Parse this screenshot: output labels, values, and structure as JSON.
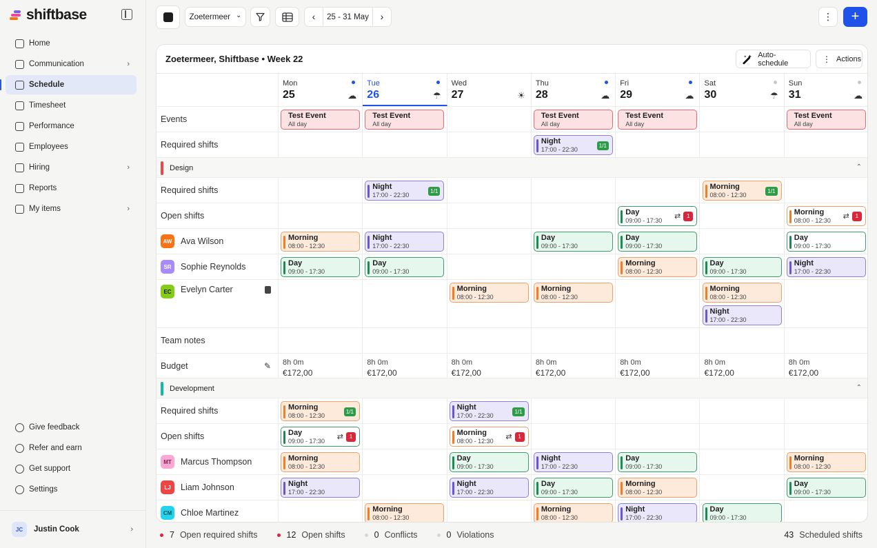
{
  "app": {
    "logo_text": "shiftbase",
    "colors": {
      "accent": "#1f52e8",
      "event": "#e02b3a",
      "night": "#6b55d3",
      "morning": "#ef7d2a",
      "day": "#1e8a52"
    }
  },
  "sidebar": {
    "items": [
      {
        "label": "Home",
        "icon": "home-icon",
        "chevron": "",
        "active": false
      },
      {
        "label": "Communication",
        "icon": "chat-icon",
        "chevron": "›",
        "active": false
      },
      {
        "label": "Schedule",
        "icon": "calendar-icon",
        "chevron": "",
        "active": true
      },
      {
        "label": "Timesheet",
        "icon": "clock-icon",
        "chevron": "",
        "active": false
      },
      {
        "label": "Performance",
        "icon": "gauge-icon",
        "chevron": "",
        "active": false
      },
      {
        "label": "Employees",
        "icon": "people-icon",
        "chevron": "",
        "active": false
      },
      {
        "label": "Hiring",
        "icon": "hiring-icon",
        "chevron": "›",
        "active": false
      },
      {
        "label": "Reports",
        "icon": "chart-icon",
        "chevron": "",
        "active": false
      },
      {
        "label": "My items",
        "icon": "list-icon",
        "chevron": "›",
        "active": false
      }
    ],
    "bottom_items": [
      {
        "label": "Give feedback",
        "icon": "megaphone-icon"
      },
      {
        "label": "Refer and earn",
        "icon": "gift-icon"
      },
      {
        "label": "Get support",
        "icon": "help-icon"
      },
      {
        "label": "Settings",
        "icon": "gear-icon"
      }
    ],
    "user": {
      "initials": "JC",
      "name": "Justin Cook",
      "chevron": "›"
    }
  },
  "toolbar": {
    "location": "Zoetermeer",
    "location_chevron": "⌄",
    "date_range": "25 - 31 May",
    "prev": "‹",
    "next": "›",
    "more": "⋮",
    "add": "+"
  },
  "panel": {
    "title": "Zoetermeer, Shiftbase • Week 22",
    "auto_schedule": "Auto-schedule",
    "actions": "Actions"
  },
  "days": [
    {
      "name": "Mon",
      "num": "25",
      "weather": "☁",
      "dot": "blue"
    },
    {
      "name": "Tue",
      "num": "26",
      "weather": "☂",
      "dot": "blue",
      "today": true
    },
    {
      "name": "Wed",
      "num": "27",
      "weather": "☀",
      "dot": "none"
    },
    {
      "name": "Thu",
      "num": "28",
      "weather": "☁",
      "dot": "blue"
    },
    {
      "name": "Fri",
      "num": "29",
      "weather": "☁",
      "dot": "blue"
    },
    {
      "name": "Sat",
      "num": "30",
      "weather": "☂",
      "dot": "grey"
    },
    {
      "name": "Sun",
      "num": "31",
      "weather": "☁",
      "dot": "grey"
    }
  ],
  "rows": {
    "events": "Events",
    "required_shifts": "Required shifts",
    "open_shifts": "Open shifts",
    "team_notes": "Team notes",
    "budget": "Budget"
  },
  "events": [
    {
      "day": 0,
      "title": "Test Event",
      "sub": "All day"
    },
    {
      "day": 1,
      "title": "Test Event",
      "sub": "All day"
    },
    {
      "day": 3,
      "title": "Test Event",
      "sub": "All day"
    },
    {
      "day": 4,
      "title": "Test Event",
      "sub": "All day"
    },
    {
      "day": 6,
      "title": "Test Event",
      "sub": "All day"
    }
  ],
  "top_required": [
    {
      "day": 3,
      "type": "night",
      "title": "Night",
      "time": "17:00 - 22:30",
      "ratio": "1/1"
    }
  ],
  "groups": [
    {
      "name": "Design",
      "bar": "#e5484d",
      "toggle": "⌃",
      "required": [
        {
          "day": 1,
          "type": "night",
          "title": "Night",
          "time": "17:00 - 22:30",
          "ratio": "1/1"
        },
        {
          "day": 5,
          "type": "morning",
          "title": "Morning",
          "time": "08:00 - 12:30",
          "ratio": "1/1"
        }
      ],
      "open": [
        {
          "day": 4,
          "type": "day",
          "title": "Day",
          "time": "09:00 - 17:30",
          "count": "1",
          "swap": "⇄"
        },
        {
          "day": 6,
          "type": "morning",
          "title": "Morning",
          "time": "08:00 - 12:30",
          "count": "1",
          "swap": "⇄"
        }
      ],
      "employees": [
        {
          "initials": "AW",
          "name": "Ava Wilson",
          "av_bg": "#f97316",
          "av_fg": "#ffffff",
          "shifts": [
            {
              "day": 0,
              "type": "morning",
              "title": "Morning",
              "time": "08:00 - 12:30"
            },
            {
              "day": 1,
              "type": "night",
              "title": "Night",
              "time": "17:00 - 22:30"
            },
            {
              "day": 3,
              "type": "day",
              "title": "Day",
              "time": "09:00 - 17:30"
            },
            {
              "day": 4,
              "type": "day",
              "title": "Day",
              "time": "09:00 - 17:30"
            },
            {
              "day": 6,
              "type": "day",
              "title": "Day",
              "time": "09:00 - 17:30",
              "plain": true
            }
          ]
        },
        {
          "initials": "SR",
          "name": "Sophie Reynolds",
          "av_bg": "#a78bfa",
          "av_fg": "#ffffff",
          "shifts": [
            {
              "day": 0,
              "type": "day",
              "title": "Day",
              "time": "09:00 - 17:30"
            },
            {
              "day": 1,
              "type": "day",
              "title": "Day",
              "time": "09:00 - 17:30"
            },
            {
              "day": 4,
              "type": "morning",
              "title": "Morning",
              "time": "08:00 - 12:30"
            },
            {
              "day": 5,
              "type": "day",
              "title": "Day",
              "time": "09:00 - 17:30"
            },
            {
              "day": 6,
              "type": "night",
              "title": "Night",
              "time": "17:00 - 22:30"
            }
          ]
        },
        {
          "initials": "EC",
          "name": "Evelyn Carter",
          "av_bg": "#84cc16",
          "av_fg": "#1a1a1a",
          "note": true,
          "shifts": [
            {
              "day": 2,
              "type": "morning",
              "title": "Morning",
              "time": "08:00 - 12:30"
            },
            {
              "day": 3,
              "type": "morning",
              "title": "Morning",
              "time": "08:00 - 12:30"
            },
            {
              "day": 5,
              "type": "morning",
              "title": "Morning",
              "time": "08:00 - 12:30"
            },
            {
              "day": 5,
              "type": "night",
              "title": "Night",
              "time": "17:00 - 22:30",
              "slot": 1
            }
          ]
        }
      ],
      "budget": [
        {
          "hours": "8h 0m",
          "eur": "€172,00"
        },
        {
          "hours": "8h 0m",
          "eur": "€172,00"
        },
        {
          "hours": "8h 0m",
          "eur": "€172,00"
        },
        {
          "hours": "8h 0m",
          "eur": "€172,00"
        },
        {
          "hours": "8h 0m",
          "eur": "€172,00"
        },
        {
          "hours": "8h 0m",
          "eur": "€172,00"
        },
        {
          "hours": "8h 0m",
          "eur": "€172,00"
        }
      ]
    },
    {
      "name": "Development",
      "bar": "#14b8a6",
      "toggle": "⌃",
      "required": [
        {
          "day": 0,
          "type": "morning",
          "title": "Morning",
          "time": "08:00 - 12:30",
          "ratio": "1/1"
        },
        {
          "day": 2,
          "type": "night",
          "title": "Night",
          "time": "17:00 - 22:30",
          "ratio": "1/1"
        }
      ],
      "open": [
        {
          "day": 0,
          "type": "day",
          "title": "Day",
          "time": "09:00 - 17:30",
          "count": "1",
          "swap": "⇄"
        },
        {
          "day": 2,
          "type": "morning",
          "title": "Morning",
          "time": "08:00 - 12:30",
          "count": "1",
          "swap": "⇄"
        }
      ],
      "employees": [
        {
          "initials": "MT",
          "name": "Marcus Thompson",
          "av_bg": "#f9a8d4",
          "av_fg": "#7a1f4a",
          "shifts": [
            {
              "day": 0,
              "type": "morning",
              "title": "Morning",
              "time": "08:00 - 12:30"
            },
            {
              "day": 2,
              "type": "day",
              "title": "Day",
              "time": "09:00 - 17:30"
            },
            {
              "day": 3,
              "type": "night",
              "title": "Night",
              "time": "17:00 - 22:30"
            },
            {
              "day": 4,
              "type": "day",
              "title": "Day",
              "time": "09:00 - 17:30"
            },
            {
              "day": 6,
              "type": "morning",
              "title": "Morning",
              "time": "08:00 - 12:30"
            }
          ]
        },
        {
          "initials": "LJ",
          "name": "Liam Johnson",
          "av_bg": "#ef4444",
          "av_fg": "#ffffff",
          "shifts": [
            {
              "day": 0,
              "type": "night",
              "title": "Night",
              "time": "17:00 - 22:30"
            },
            {
              "day": 2,
              "type": "night",
              "title": "Night",
              "time": "17:00 - 22:30"
            },
            {
              "day": 3,
              "type": "day",
              "title": "Day",
              "time": "09:00 - 17:30"
            },
            {
              "day": 4,
              "type": "morning",
              "title": "Morning",
              "time": "08:00 - 12:30"
            },
            {
              "day": 6,
              "type": "day",
              "title": "Day",
              "time": "09:00 - 17:30"
            }
          ]
        },
        {
          "initials": "CM",
          "name": "Chloe Martinez",
          "av_bg": "#22d3ee",
          "av_fg": "#0b4a55",
          "shifts": [
            {
              "day": 1,
              "type": "morning",
              "title": "Morning",
              "time": "08:00 - 12:30"
            },
            {
              "day": 3,
              "type": "morning",
              "title": "Morning",
              "time": "08:00 - 12:30"
            },
            {
              "day": 4,
              "type": "night",
              "title": "Night",
              "time": "17:00 - 22:30"
            },
            {
              "day": 5,
              "type": "day",
              "title": "Day",
              "time": "09:00 - 17:30"
            }
          ]
        }
      ]
    }
  ],
  "footer": {
    "open_required": {
      "num": "7",
      "label": "Open required shifts",
      "color": "#d9263a"
    },
    "open_shifts": {
      "num": "12",
      "label": "Open shifts",
      "color": "#d9263a"
    },
    "conflicts": {
      "num": "0",
      "label": "Conflicts",
      "color": "#d6d6d6"
    },
    "violations": {
      "num": "0",
      "label": "Violations",
      "color": "#d6d6d6"
    },
    "scheduled": {
      "num": "43",
      "label": "Scheduled shifts"
    }
  }
}
